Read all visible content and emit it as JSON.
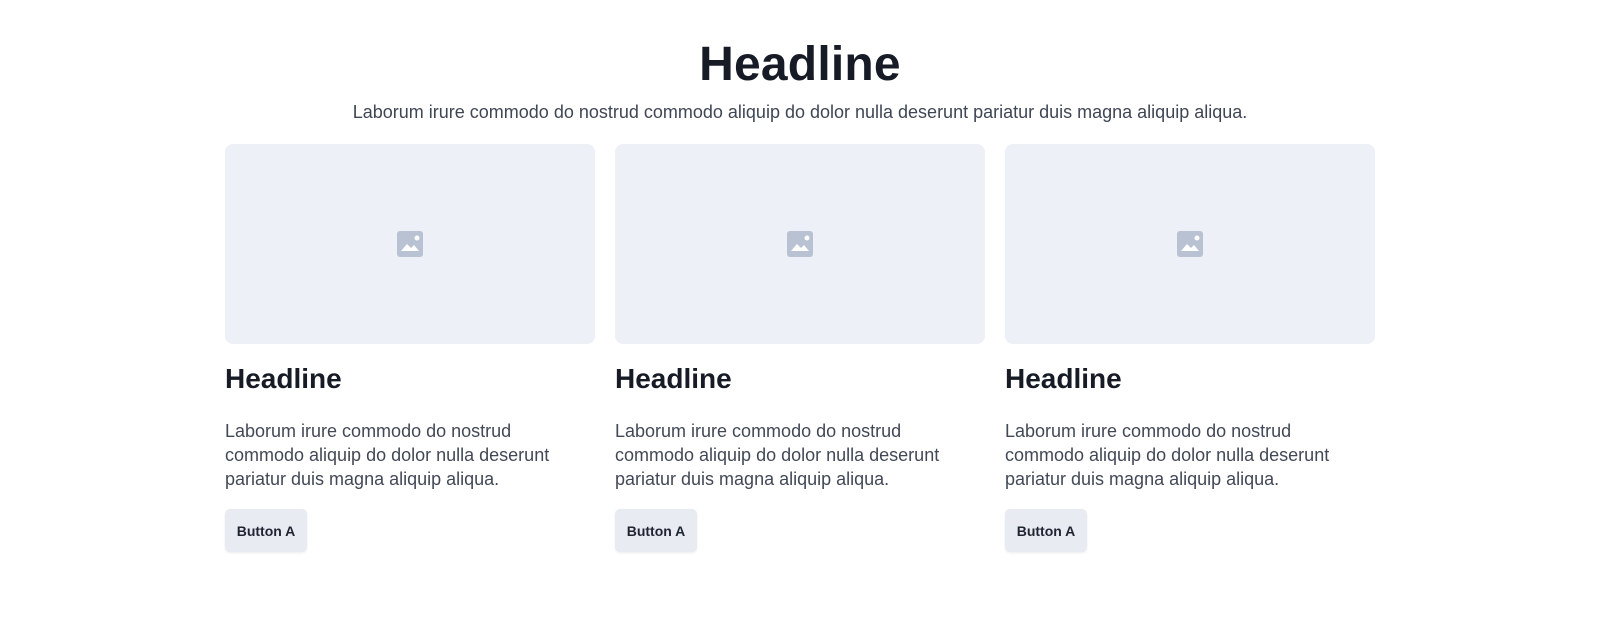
{
  "page": {
    "title": "Headline",
    "subtitle": "Laborum irure commodo do nostrud commodo aliquip do dolor nulla deserunt pariatur duis magna aliquip aliqua."
  },
  "cards": [
    {
      "image_icon": "image-icon",
      "title": "Headline",
      "text": "Laborum irure commodo do nostrud commodo aliquip do dolor nulla deserunt pariatur duis magna aliquip aliqua.",
      "button_label": "Button A"
    },
    {
      "image_icon": "image-icon",
      "title": "Headline",
      "text": "Laborum irure commodo do nostrud commodo aliquip do dolor nulla deserunt pariatur duis magna aliquip aliqua.",
      "button_label": "Button A"
    },
    {
      "image_icon": "image-icon",
      "title": "Headline",
      "text": "Laborum irure commodo do nostrud commodo aliquip do dolor nulla deserunt pariatur duis magna aliquip aliqua.",
      "button_label": "Button A"
    }
  ],
  "colors": {
    "placeholder_background": "#edf0f6",
    "placeholder_icon": "#b8c2d3",
    "button_background": "#e8ebf2",
    "heading_text": "#161b26",
    "body_text": "#424856"
  }
}
